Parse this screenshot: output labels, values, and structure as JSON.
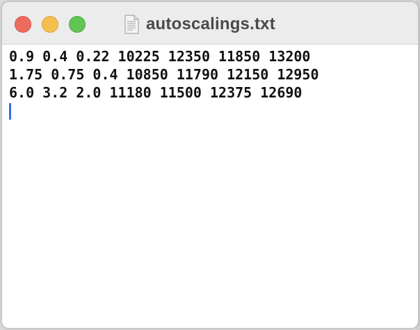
{
  "window": {
    "title": "autoscalings.txt",
    "title_icon": "text-document-icon"
  },
  "titlebar": {
    "buttons": [
      {
        "name": "close",
        "color": "#ed6a5e"
      },
      {
        "name": "minimize",
        "color": "#f5bf4f"
      },
      {
        "name": "zoom",
        "color": "#61c554"
      }
    ]
  },
  "editor": {
    "lines": [
      "0.9 0.4 0.22 10225 12350 11850 13200",
      "1.75 0.75 0.4 10850 11790 12150 12950",
      "6.0 3.2 2.0 11180 11500 12375 12690"
    ],
    "caret_color": "#2f6fe5"
  }
}
